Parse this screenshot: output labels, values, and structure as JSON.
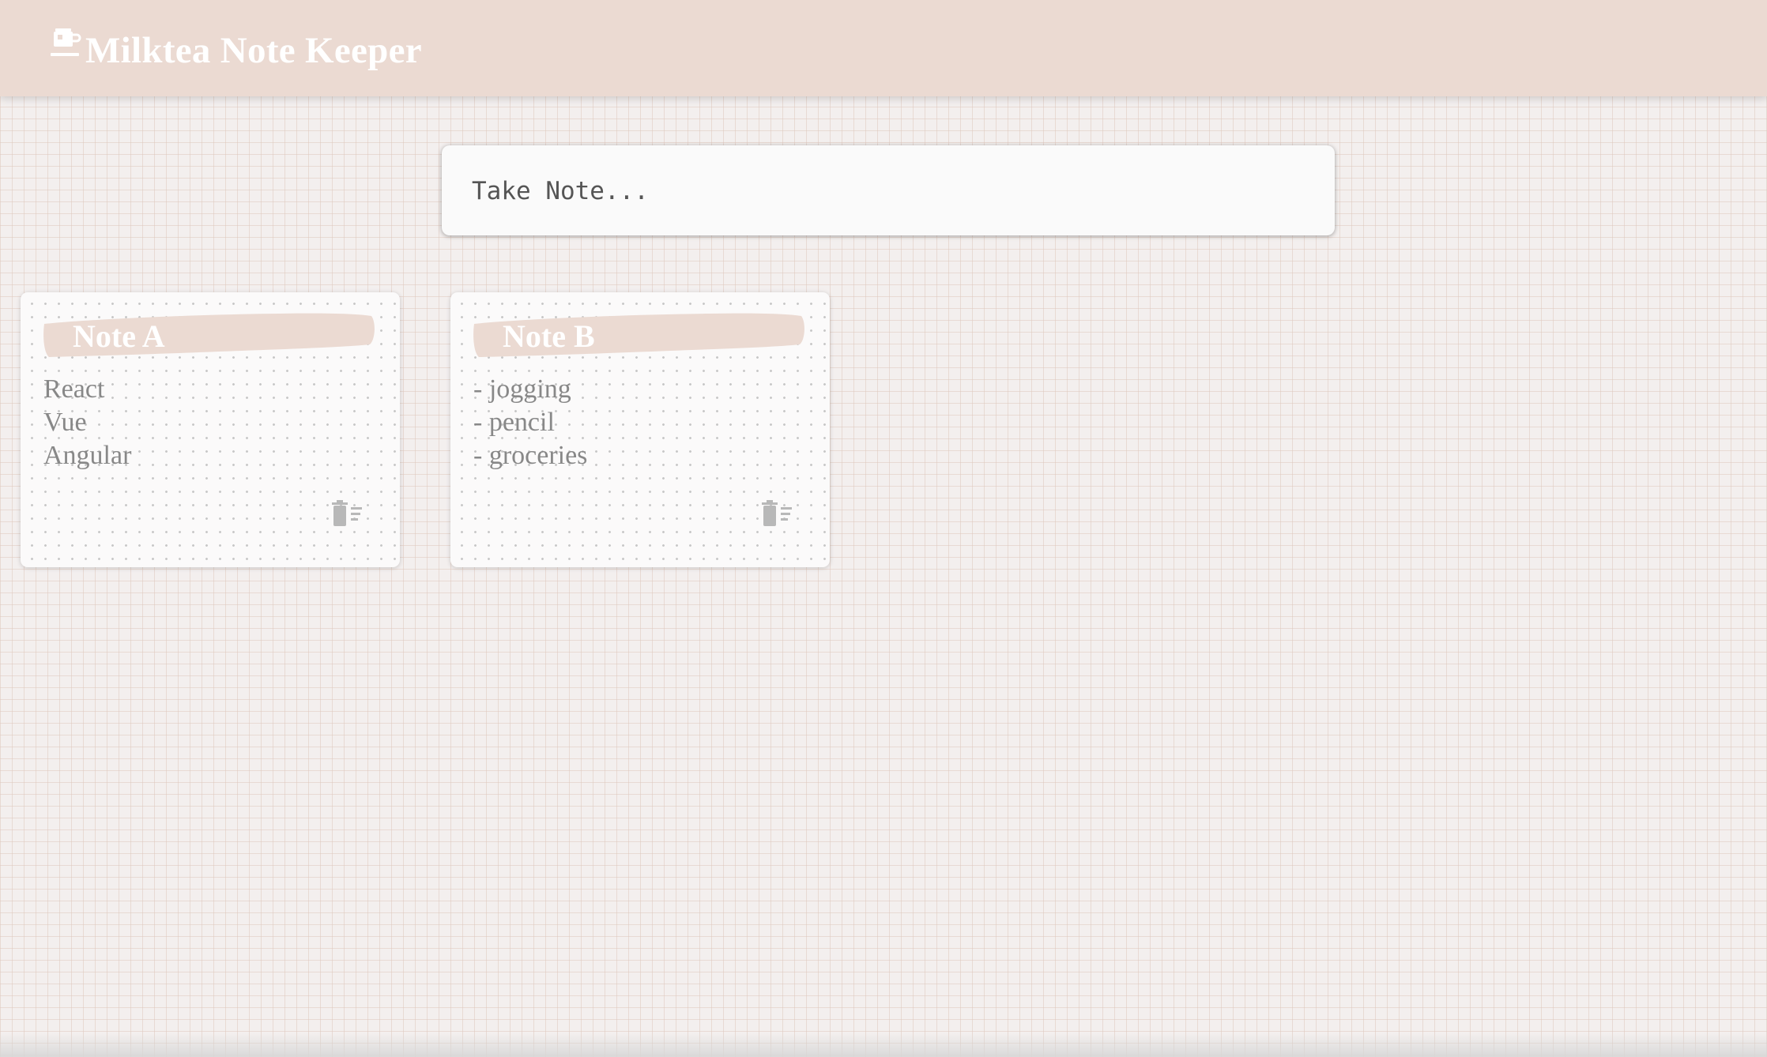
{
  "header": {
    "title": "Milktea Note Keeper",
    "icon": "milktea-cup-icon"
  },
  "compose": {
    "placeholder": "Take Note..."
  },
  "notes": [
    {
      "title": "Note A",
      "lines": [
        "React",
        "Vue",
        "Angular"
      ],
      "delete_icon": "trash-icon"
    },
    {
      "title": "Note B",
      "lines": [
        "- jogging",
        "- pencil",
        "- groceries"
      ],
      "delete_icon": "trash-icon"
    }
  ],
  "colors": {
    "header_bg": "#ebdad2",
    "title_band": "#ebdad2",
    "page_bg": "#f3efee",
    "note_text": "#888888",
    "icon_gray": "#b8b8b8"
  }
}
